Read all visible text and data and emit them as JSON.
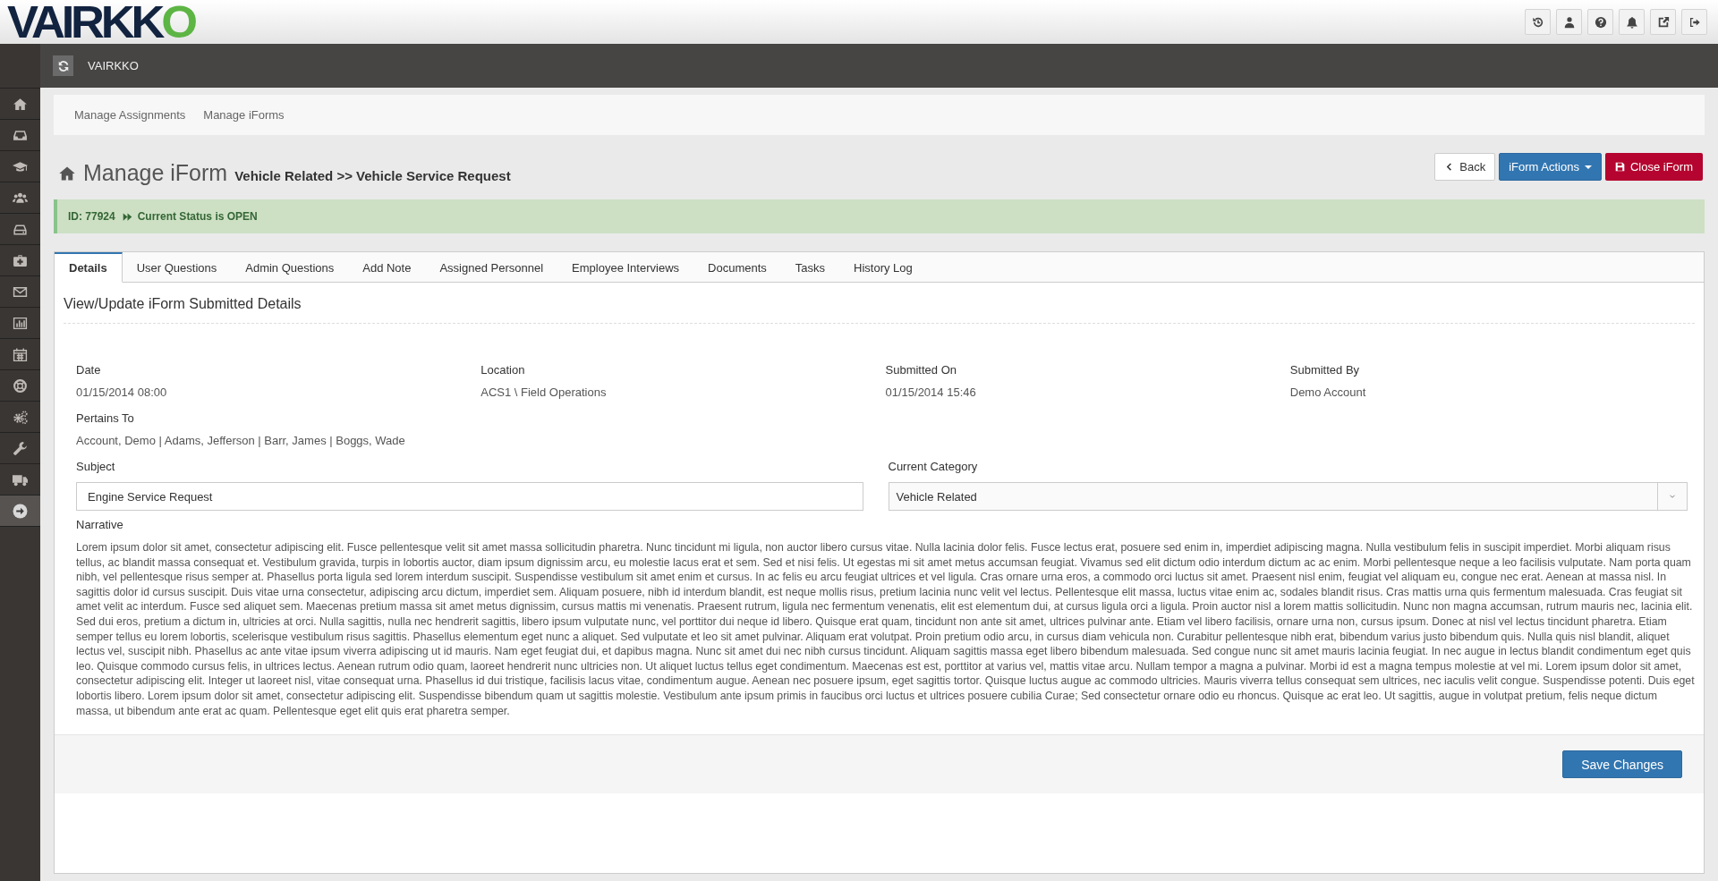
{
  "header": {
    "logo": "VAIRKKO"
  },
  "topbar": {
    "title": "VAIRKKO"
  },
  "sidebar": {
    "items": [
      {
        "selected": false
      },
      {
        "selected": false
      },
      {
        "selected": false
      },
      {
        "selected": false
      },
      {
        "selected": false
      },
      {
        "selected": false
      },
      {
        "selected": false
      },
      {
        "selected": false
      },
      {
        "selected": false
      },
      {
        "selected": false
      },
      {
        "selected": false
      },
      {
        "selected": false
      },
      {
        "selected": false
      },
      {
        "selected": true
      }
    ]
  },
  "breadcrumbs": [
    "Manage Assignments",
    "Manage iForms"
  ],
  "page": {
    "title": "Manage iForm",
    "subtitle": "Vehicle Related >> Vehicle Service Request",
    "buttons": [
      {
        "kind": "back",
        "label": "Back"
      },
      {
        "kind": "actions",
        "label": "iForm Actions"
      },
      {
        "kind": "close",
        "label": "Close iForm"
      }
    ]
  },
  "status": {
    "id": "ID: 77924",
    "text": "Current Status is OPEN"
  },
  "tabs": [
    {
      "label": "Details",
      "selected": true
    },
    {
      "label": "User Questions",
      "selected": false
    },
    {
      "label": "Admin Questions",
      "selected": false
    },
    {
      "label": "Add Note",
      "selected": false
    },
    {
      "label": "Assigned Personnel",
      "selected": false
    },
    {
      "label": "Employee Interviews",
      "selected": false
    },
    {
      "label": "Documents",
      "selected": false
    },
    {
      "label": "Tasks",
      "selected": false
    },
    {
      "label": "History Log",
      "selected": false
    }
  ],
  "section_title": "View/Update iForm Submitted Details",
  "details": [
    {
      "label": "Date",
      "value": "01/15/2014 08:00"
    },
    {
      "label": "Location",
      "value": "ACS1 \\ Field Operations"
    },
    {
      "label": "Submitted On",
      "value": "01/15/2014 15:46"
    },
    {
      "label": "Submitted By",
      "value": "Demo Account"
    }
  ],
  "pertains_to": {
    "label": "Pertains To",
    "value": "Account, Demo | Adams, Jefferson | Barr, James | Boggs, Wade"
  },
  "subject": {
    "label": "Subject",
    "value": "Engine Service Request"
  },
  "category": {
    "label": "Current Category",
    "value": "Vehicle Related"
  },
  "narrative": {
    "label": "Narrative",
    "text": "Lorem ipsum dolor sit amet, consectetur adipiscing elit. Fusce pellentesque velit sit amet massa sollicitudin pharetra. Nunc tincidunt mi ligula, non auctor libero cursus vitae. Nulla lacinia dolor felis. Fusce lectus erat, posuere sed enim in, imperdiet adipiscing magna. Nulla vestibulum felis in suscipit imperdiet. Morbi aliquam risus tellus, ac blandit massa consequat et. Vestibulum gravida, turpis in lobortis auctor, diam ipsum dignissim arcu, eu molestie lacus erat et sem. Sed et nisi felis. Ut egestas mi sit amet metus accumsan feugiat. Vivamus sed elit dictum odio interdum dictum ac ac enim. Morbi pellentesque neque a leo facilisis vulputate. Nam porta quam nibh, vel pellentesque risus semper at. Phasellus porta ligula sed lorem interdum suscipit. Suspendisse vestibulum sit amet enim et cursus. In ac felis eu arcu feugiat ultrices et vel ligula. Cras ornare urna eros, a commodo orci luctus sit amet. Praesent nisl enim, feugiat vel aliquam eu, congue nec erat. Aenean at massa nisl. In sagittis dolor id cursus suscipit. Duis vitae urna consectetur, adipiscing arcu dictum, imperdiet sem. Aliquam posuere, nibh id interdum blandit, est neque mollis risus, pretium lacinia nunc velit vel lectus. Pellentesque elit massa, luctus vitae enim ac, sodales blandit risus. Cras mattis urna quis fermentum malesuada. Cras feugiat sit amet velit ac interdum. Fusce sed aliquet sem. Maecenas pretium massa sit amet metus dignissim, cursus mattis mi venenatis. Praesent rutrum, ligula nec fermentum venenatis, elit est elementum dui, at cursus ligula orci a ligula. Proin auctor nisl a lorem mattis sollicitudin. Nunc non magna accumsan, rutrum mauris nec, lacinia elit. Sed dui eros, pretium a dictum in, ultricies at orci. Nulla sagittis, nulla nec hendrerit sagittis, libero ipsum vulputate nunc, vel porttitor dui neque id libero. Quisque erat quam, tincidunt non ante sit amet, ultrices pulvinar ante. Etiam vel libero facilisis, ornare urna non, cursus ipsum. Donec at nisl vel lectus tincidunt pharetra. Etiam semper tellus eu lorem lobortis, scelerisque vestibulum risus sagittis. Phasellus elementum eget nunc a aliquet. Sed vulputate et leo sit amet pulvinar. Aliquam erat volutpat. Proin pretium odio arcu, in cursus diam vehicula non. Curabitur pellentesque nibh erat, bibendum varius justo bibendum quis. Nulla quis nisl blandit, aliquet lectus vel, suscipit nibh. Phasellus ac ante vitae ipsum viverra adipiscing ut id mauris. Nam eget feugiat dui, et dapibus magna. Nunc sit amet dui nec nibh cursus tincidunt. Aliquam sagittis massa eget libero bibendum malesuada. Sed congue nunc sit amet mauris lacinia feugiat. In nec augue in lectus blandit condimentum eget quis leo. Quisque commodo cursus felis, in ultrices lectus. Aenean rutrum odio quam, laoreet hendrerit nunc ultricies non. Ut aliquet luctus tellus eget condimentum. Maecenas est est, porttitor at varius vel, mattis vitae arcu. Nullam tempor a magna a pulvinar. Morbi id est a magna tempus molestie at vel mi. Lorem ipsum dolor sit amet, consectetur adipiscing elit. Integer ut laoreet nisl, vitae consequat urna. Phasellus id dui tristique, facilisis lacus vitae, condimentum augue. Aenean nec posuere ipsum, eget sagittis tortor. Quisque luctus augue ac commodo ultricies. Mauris viverra tellus consequat sem ultrices, nec iaculis velit congue. Suspendisse potenti. Duis eget lobortis libero. Lorem ipsum dolor sit amet, consectetur adipiscing elit. Suspendisse bibendum quam ut sagittis molestie. Vestibulum ante ipsum primis in faucibus orci luctus et ultrices posuere cubilia Curae; Sed consectetur ornare odio eu rhoncus. Quisque ac erat leo. Ut sagittis, augue in volutpat pretium, felis neque dictum massa, ut bibendum ante erat ac quam. Pellentesque eget elit quis erat pharetra semper."
  },
  "save_button": {
    "label": "Save Changes"
  }
}
